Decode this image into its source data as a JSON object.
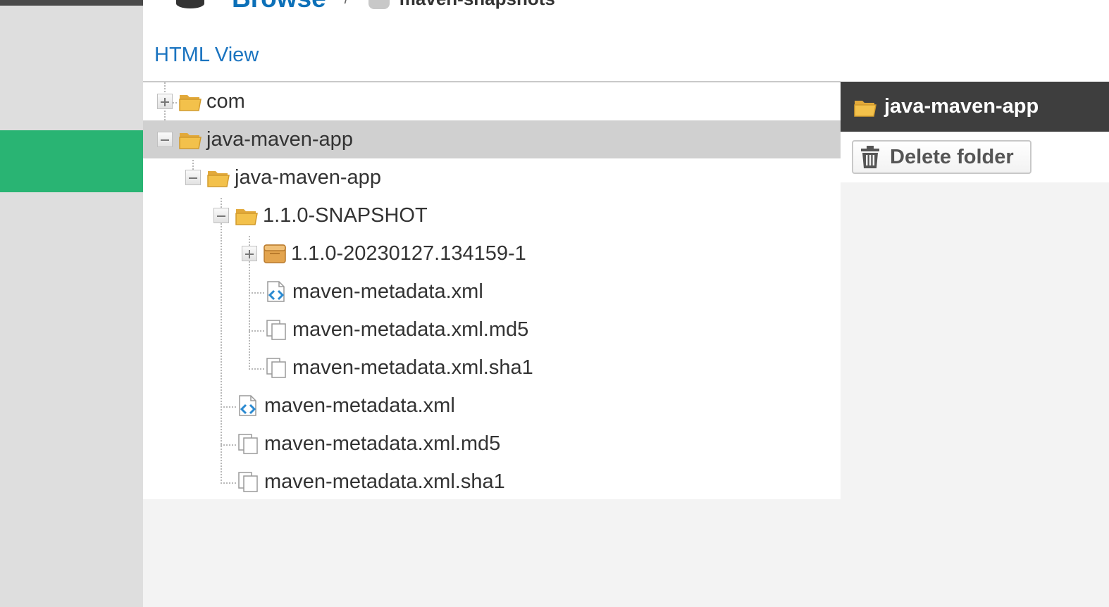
{
  "breadcrumb": {
    "browse_label": "Browse",
    "separator": "/",
    "repository_name": "maven-snapshots"
  },
  "view_toggle_label": "HTML View",
  "tree": {
    "nodes": [
      {
        "label": "com",
        "icon": "folder-icon",
        "toggle": "expand"
      },
      {
        "label": "java-maven-app",
        "icon": "folder-icon",
        "toggle": "collapse",
        "selected": true
      },
      {
        "label": "java-maven-app",
        "icon": "folder-icon",
        "toggle": "collapse"
      },
      {
        "label": "1.1.0-SNAPSHOT",
        "icon": "folder-icon",
        "toggle": "collapse"
      },
      {
        "label": "1.1.0-20230127.134159-1",
        "icon": "package-icon",
        "toggle": "expand"
      },
      {
        "label": "maven-metadata.xml",
        "icon": "xml-file-icon"
      },
      {
        "label": "maven-metadata.xml.md5",
        "icon": "file-copy-icon"
      },
      {
        "label": "maven-metadata.xml.sha1",
        "icon": "file-copy-icon"
      },
      {
        "label": "maven-metadata.xml",
        "icon": "xml-file-icon"
      },
      {
        "label": "maven-metadata.xml.md5",
        "icon": "file-copy-icon"
      },
      {
        "label": "maven-metadata.xml.sha1",
        "icon": "file-copy-icon"
      }
    ]
  },
  "details_panel": {
    "title": "java-maven-app",
    "delete_button_label": "Delete folder"
  },
  "colors": {
    "link_blue": "#1b74c0",
    "nav_active_green": "#29b473",
    "panel_header_dark": "#3e3e3e",
    "folder_yellow": "#f3c14b",
    "selected_row": "#d0d0d0"
  }
}
